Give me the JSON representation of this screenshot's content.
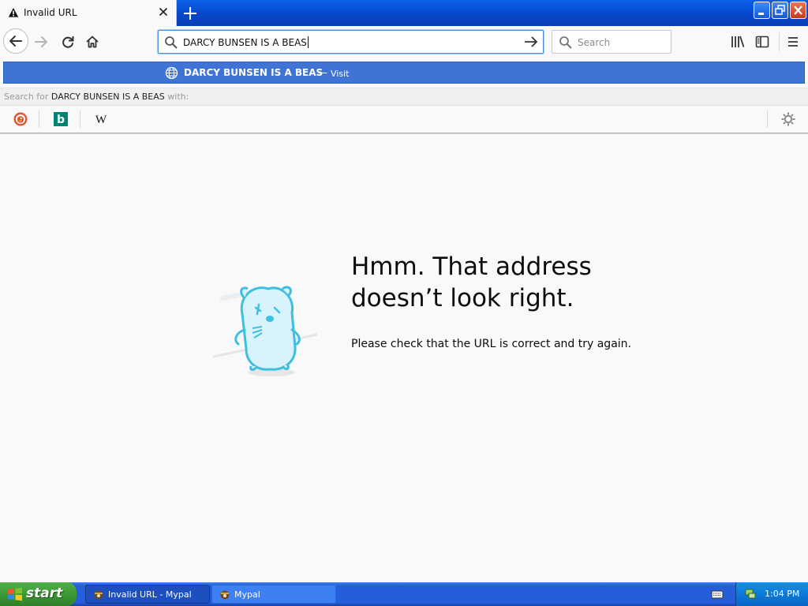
{
  "tab": {
    "title": "Invalid URL"
  },
  "urlbar": {
    "value": "DARCY BUNSEN IS A BEAS"
  },
  "searchbox": {
    "placeholder": "Search"
  },
  "dropdown": {
    "suggestion": {
      "title": "DARCY BUNSEN IS A BEAS",
      "separator": "—",
      "action": "Visit"
    },
    "oneoff_header": {
      "prefix": "Search for",
      "term": "DARCY BUNSEN IS A BEAS",
      "suffix": "with:"
    },
    "engines": [
      {
        "name": "DuckDuckGo",
        "icon": "duckduckgo-icon"
      },
      {
        "name": "Bing",
        "icon": "bing-icon",
        "glyph": "b"
      },
      {
        "name": "Wikipedia",
        "icon": "wikipedia-icon",
        "glyph": "W"
      }
    ]
  },
  "error_page": {
    "title_line1": "Hmm. That address",
    "title_line2": "doesn’t look right.",
    "description": "Please check that the URL is correct and try again."
  },
  "taskbar": {
    "start_label": "start",
    "tasks": [
      {
        "label": "Invalid URL - Mypal"
      },
      {
        "label": "Mypal"
      }
    ],
    "clock": "1:04 PM"
  },
  "colors": {
    "accent": "#3f74d6",
    "xp_taskbar": "#245edb",
    "xp_start": "#3c9a36",
    "page_bg": "#f9f9fa"
  }
}
